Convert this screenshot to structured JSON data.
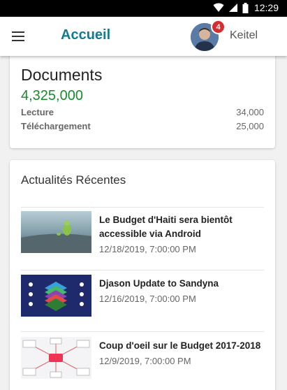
{
  "status_bar": {
    "time": "12:29"
  },
  "header": {
    "title": "Accueil",
    "user_name": "Keitel",
    "notification_count": "4"
  },
  "documents": {
    "title": "Documents",
    "total": "4,325,000",
    "stats": [
      {
        "label": "Lecture",
        "value": "34,000"
      },
      {
        "label": "Téléchargement",
        "value": "25,000"
      }
    ]
  },
  "news": {
    "title": "Actualités Récentes",
    "items": [
      {
        "headline": "Le Budget d'Haiti sera bientôt accessible via Android",
        "date": "12/18/2019, 7:00:00 PM"
      },
      {
        "headline": "Djason Update to Sandyna",
        "date": "12/16/2019, 7:00:00 PM"
      },
      {
        "headline": "Coup d'oeil sur le Budget 2017-2018",
        "date": "12/9/2019, 7:00:00 PM"
      }
    ]
  },
  "colors": {
    "accent": "#167a8e",
    "total_green": "#1b8a2c",
    "badge_red": "#d32f2f"
  }
}
